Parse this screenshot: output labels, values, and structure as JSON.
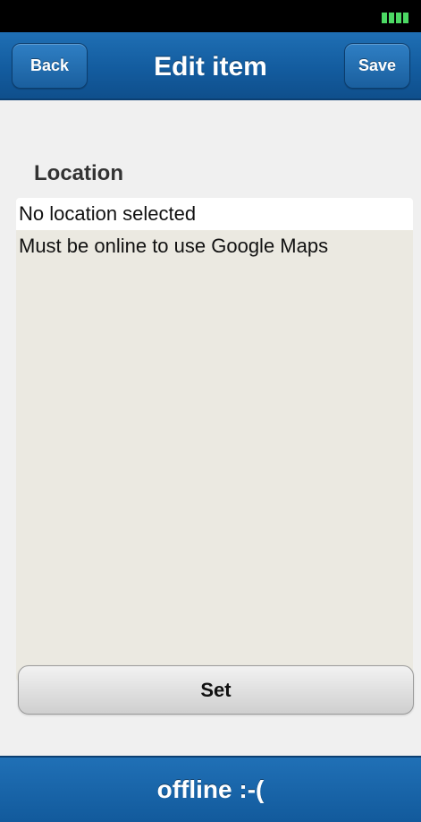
{
  "status_bar": {
    "battery_icon": "battery-full-icon",
    "battery_color": "#4cd964"
  },
  "header": {
    "title": "Edit item",
    "back_label": "Back",
    "save_label": "Save"
  },
  "location": {
    "label": "Location",
    "value": "No location selected",
    "note": "Must be online to use Google Maps",
    "set_label": "Set"
  },
  "footer": {
    "status_text": "offline :-("
  },
  "colors": {
    "header_blue": "#135c9f",
    "panel_bg": "#ebe9e1",
    "page_bg": "#f0f0f0"
  }
}
